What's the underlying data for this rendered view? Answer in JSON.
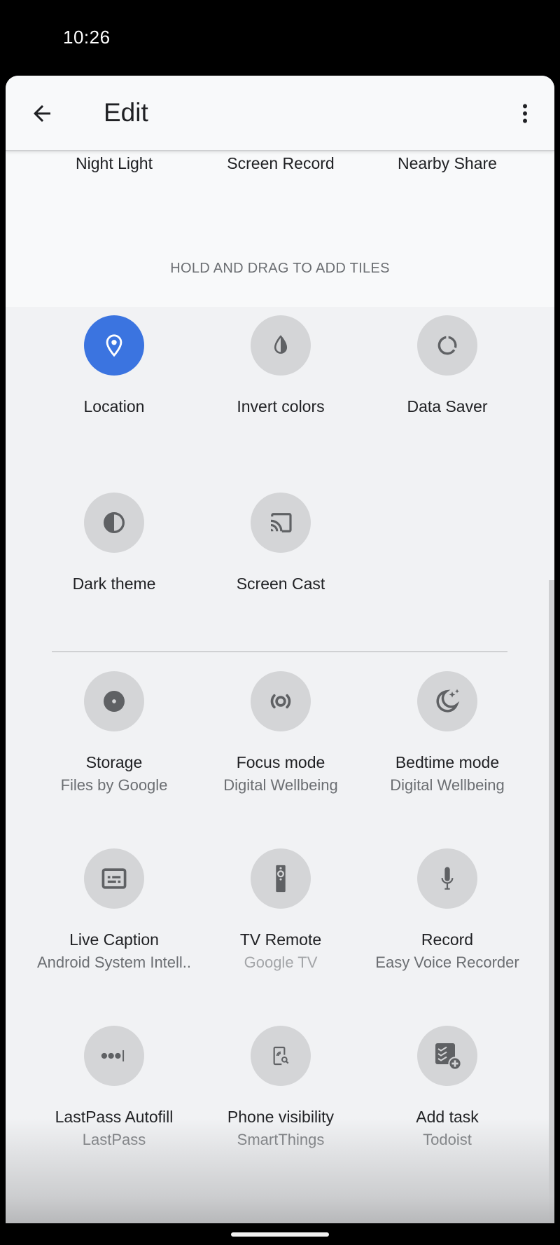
{
  "status_bar": {
    "time": "10:26"
  },
  "header": {
    "title": "Edit",
    "back_icon": "arrow-back-icon",
    "more_icon": "more-vert-icon"
  },
  "current_tiles": [
    "Night Light",
    "Screen Record",
    "Nearby Share"
  ],
  "hint": "HOLD AND DRAG TO ADD TILES",
  "colors": {
    "accent": "#3b74e0",
    "tile_bg": "#d4d5d7",
    "icon": "#5f6164"
  },
  "available_tiles": [
    {
      "label": "Location",
      "icon": "location-pin-icon",
      "active": true
    },
    {
      "label": "Invert colors",
      "icon": "invert-colors-icon"
    },
    {
      "label": "Data Saver",
      "icon": "data-saver-icon"
    },
    {
      "label": "Dark theme",
      "icon": "dark-theme-icon"
    },
    {
      "label": "Screen Cast",
      "icon": "cast-icon"
    }
  ],
  "third_party_tiles": [
    {
      "label": "Storage",
      "sub": "Files by Google",
      "icon": "storage-disc-icon"
    },
    {
      "label": "Focus mode",
      "sub": "Digital Wellbeing",
      "icon": "focus-mode-icon"
    },
    {
      "label": "Bedtime mode",
      "sub": "Digital Wellbeing",
      "icon": "bedtime-moon-icon"
    },
    {
      "label": "Live Caption",
      "sub": "Android System Intell..",
      "icon": "live-caption-icon"
    },
    {
      "label": "TV Remote",
      "sub": "Google TV",
      "icon": "tv-remote-icon",
      "sub_dim": true
    },
    {
      "label": "Record",
      "sub": "Easy Voice Recorder",
      "icon": "microphone-icon"
    },
    {
      "label": "LastPass Autofill",
      "sub": "LastPass",
      "icon": "password-dots-icon"
    },
    {
      "label": "Phone visibility",
      "sub": "SmartThings",
      "icon": "phone-search-icon"
    },
    {
      "label": "Add task",
      "sub": "Todoist",
      "icon": "add-task-icon"
    }
  ]
}
